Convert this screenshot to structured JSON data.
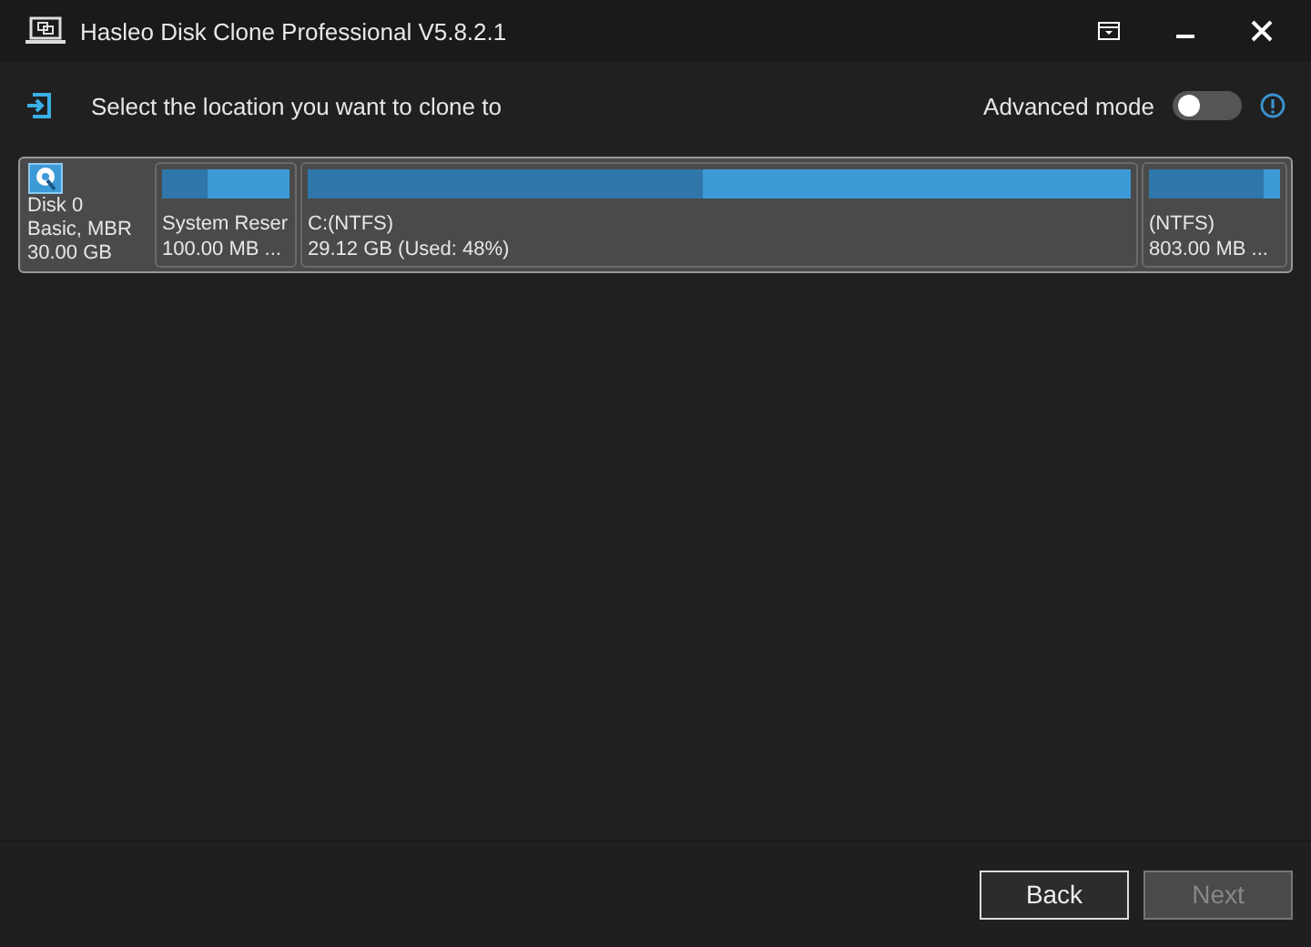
{
  "window": {
    "title": "Hasleo Disk Clone Professional V5.8.2.1"
  },
  "header": {
    "instruction": "Select the location you want to clone to",
    "advanced_mode": {
      "label": "Advanced mode",
      "on": false
    }
  },
  "disk": {
    "name": "Disk 0",
    "type": "Basic, MBR",
    "size": "30.00 GB",
    "selected": true,
    "partitions": [
      {
        "name": "System Reser",
        "detail": "100.00 MB ...",
        "level": 0.35
      },
      {
        "name": "C:(NTFS)",
        "detail": "29.12 GB (Used: 48%)",
        "level": 0.48
      },
      {
        "name": "(NTFS)",
        "detail": "803.00 MB ...",
        "level": 0.88
      }
    ]
  },
  "buttons": [
    {
      "label": "Back",
      "disabled": false
    },
    {
      "label": "Next",
      "disabled": true
    }
  ]
}
